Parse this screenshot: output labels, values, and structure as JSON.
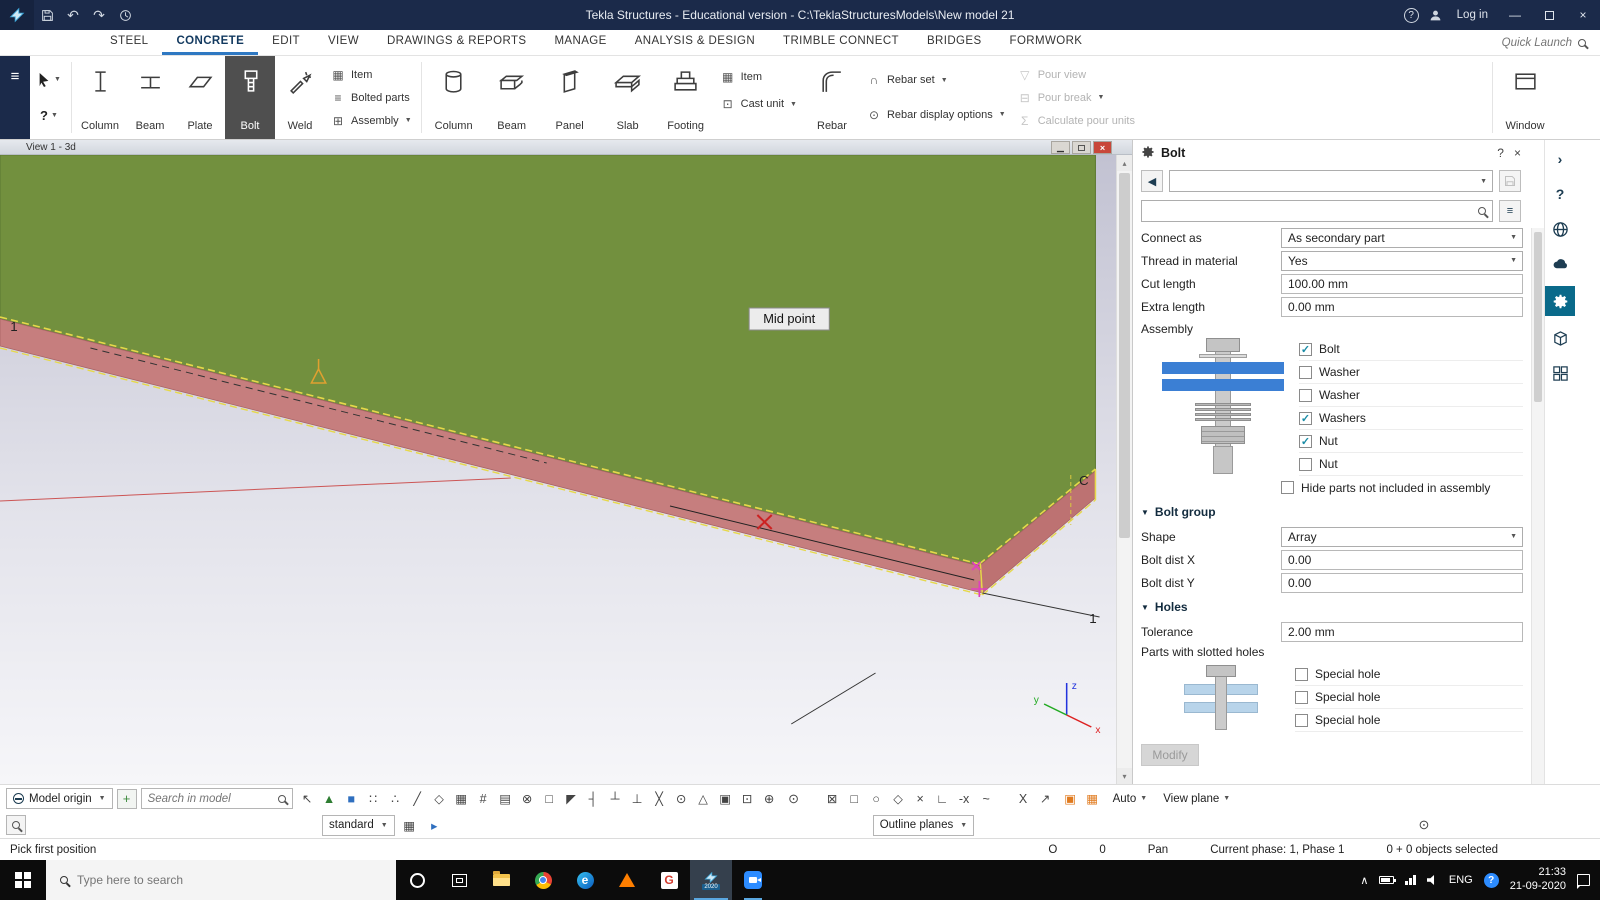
{
  "titlebar": {
    "title": "Tekla Structures - Educational version - C:\\TeklaStructuresModels\\New model 21",
    "login": "Log in"
  },
  "tabs": {
    "quick_launch": "Quick Launch",
    "items": [
      {
        "name": "tab-steel",
        "label": "STEEL"
      },
      {
        "name": "tab-concrete",
        "label": "CONCRETE",
        "active": true
      },
      {
        "name": "tab-edit",
        "label": "EDIT"
      },
      {
        "name": "tab-view",
        "label": "VIEW"
      },
      {
        "name": "tab-drawings-reports",
        "label": "DRAWINGS & REPORTS"
      },
      {
        "name": "tab-manage",
        "label": "MANAGE"
      },
      {
        "name": "tab-analysis-design",
        "label": "ANALYSIS & DESIGN"
      },
      {
        "name": "tab-trimble-connect",
        "label": "TRIMBLE CONNECT"
      },
      {
        "name": "tab-bridges",
        "label": "BRIDGES"
      },
      {
        "name": "tab-formwork",
        "label": "FORMWORK"
      }
    ]
  },
  "ribbon": {
    "steel_tiles": [
      {
        "label": "Column"
      },
      {
        "label": "Beam"
      },
      {
        "label": "Plate"
      },
      {
        "label": "Bolt",
        "active": true
      },
      {
        "label": "Weld"
      }
    ],
    "steel_stack": [
      {
        "label": "Item"
      },
      {
        "label": "Bolted parts"
      },
      {
        "label": "Assembly"
      }
    ],
    "concrete_tiles": [
      {
        "label": "Column"
      },
      {
        "label": "Beam"
      },
      {
        "label": "Panel"
      },
      {
        "label": "Slab"
      },
      {
        "label": "Footing"
      }
    ],
    "concrete_stack": [
      {
        "label": "Item"
      },
      {
        "label": "Cast unit"
      }
    ],
    "rebar_tile": {
      "label": "Rebar"
    },
    "rebar_stack": [
      {
        "label": "Rebar set"
      },
      {
        "label": "Rebar display options"
      }
    ],
    "pour_stack": [
      {
        "label": "Pour view"
      },
      {
        "label": "Pour break"
      },
      {
        "label": "Calculate pour units"
      }
    ],
    "window_tile": {
      "label": "Window"
    }
  },
  "viewport": {
    "window_title": "View 1 - 3d",
    "tooltip": "Mid point",
    "grid_left": "1",
    "grid_bottom": "1",
    "grid_c": "C",
    "axis_x": "x",
    "axis_y": "y",
    "axis_z": "z"
  },
  "bolt_panel": {
    "title": "Bolt",
    "connect_as": {
      "label": "Connect as",
      "value": "As secondary part"
    },
    "thread": {
      "label": "Thread in material",
      "value": "Yes"
    },
    "cut_length": {
      "label": "Cut length",
      "value": "100.00 mm"
    },
    "extra_length": {
      "label": "Extra length",
      "value": "0.00 mm"
    },
    "assembly_label": "Assembly",
    "assembly_checks": [
      {
        "name": "check-bolt",
        "label": "Bolt",
        "checked": true
      },
      {
        "name": "check-washer-1",
        "label": "Washer",
        "checked": false
      },
      {
        "name": "check-washer-2",
        "label": "Washer",
        "checked": false
      },
      {
        "name": "check-washers",
        "label": "Washers",
        "checked": true
      },
      {
        "name": "check-nut-1",
        "label": "Nut",
        "checked": true
      },
      {
        "name": "check-nut-2",
        "label": "Nut",
        "checked": false
      }
    ],
    "hide_parts": "Hide parts not included in assembly",
    "group": {
      "title": "Bolt group",
      "shape": {
        "label": "Shape",
        "value": "Array"
      },
      "dist_x": {
        "label": "Bolt dist X",
        "value": "0.00"
      },
      "dist_y": {
        "label": "Bolt dist Y",
        "value": "0.00"
      }
    },
    "holes": {
      "title": "Holes",
      "tolerance": {
        "label": "Tolerance",
        "value": "2.00 mm"
      },
      "slotted_label": "Parts with slotted holes",
      "special": [
        {
          "name": "special-hole-1",
          "label": "Special hole",
          "checked": false
        },
        {
          "name": "special-hole-2",
          "label": "Special hole",
          "checked": false
        },
        {
          "name": "special-hole-3",
          "label": "Special hole",
          "checked": false
        }
      ]
    },
    "modify_label": "Modify"
  },
  "bottom": {
    "model_origin": "Model origin",
    "search_placeholder": "Search in model",
    "standard": "standard",
    "outline_planes": "Outline planes",
    "auto": "Auto",
    "view_plane": "View plane",
    "snap_row1": [
      {
        "name": "select-cursor-icon",
        "glyph": "↖"
      },
      {
        "name": "select-components-icon",
        "glyph": "▲",
        "color": "#2e7d32"
      },
      {
        "name": "select-objects-icon",
        "glyph": "■",
        "color": "#2f6fbf"
      },
      {
        "name": "snap-reference-points-icon",
        "glyph": "∷"
      },
      {
        "name": "snap-geometry-points-icon",
        "glyph": "∴"
      },
      {
        "name": "snap-line-icon",
        "glyph": "╱"
      },
      {
        "name": "snap-polygon-icon",
        "glyph": "◇"
      },
      {
        "name": "snap-grid-icon",
        "glyph": "▦"
      },
      {
        "name": "snap-grid-lines-icon",
        "glyph": "#"
      },
      {
        "name": "snap-plane-icon",
        "glyph": "▤"
      },
      {
        "name": "snap-cut-icon",
        "glyph": "⊗"
      },
      {
        "name": "snap-box-icon",
        "glyph": "□"
      },
      {
        "name": "snap-corner-icon",
        "glyph": "◤"
      },
      {
        "name": "snap-end-point-icon",
        "glyph": "┤"
      },
      {
        "name": "snap-mid-point-icon",
        "glyph": "┴"
      },
      {
        "name": "snap-perpendicular-icon",
        "glyph": "⊥"
      },
      {
        "name": "snap-intersection-icon",
        "glyph": "╳"
      },
      {
        "name": "snap-center-icon",
        "glyph": "⊙"
      },
      {
        "name": "snap-tangent-icon",
        "glyph": "△"
      },
      {
        "name": "snap-nearest-icon",
        "glyph": "▣"
      },
      {
        "name": "snap-any-icon",
        "glyph": "⊡"
      },
      {
        "name": "snap-free-icon",
        "glyph": "⊕"
      }
    ],
    "view_tools": [
      {
        "name": "clip-plane-icon",
        "glyph": "⊠"
      },
      {
        "name": "view-rect-icon",
        "glyph": "□"
      },
      {
        "name": "view-circle-icon",
        "glyph": "○"
      },
      {
        "name": "view-diamond-icon",
        "glyph": "◇"
      },
      {
        "name": "delete-mark-icon",
        "glyph": "×"
      },
      {
        "name": "ortho-view-icon",
        "glyph": "∟"
      },
      {
        "name": "minus-x-icon",
        "glyph": "-x"
      },
      {
        "name": "axis-lock-icon",
        "glyph": "~"
      }
    ],
    "zoom_tools": [
      {
        "name": "zoom-selected-icon",
        "glyph": "X"
      },
      {
        "name": "pan-arrow-icon",
        "glyph": "↗"
      }
    ],
    "orange_tools": [
      {
        "name": "work-plane-icon",
        "glyph": "▣",
        "color": "#e07a1e"
      },
      {
        "name": "work-area-icon",
        "glyph": "▦",
        "color": "#e07a1e"
      }
    ]
  },
  "statusbar": {
    "left": "Pick first position",
    "o": "O",
    "zero": "0",
    "pan": "Pan",
    "phase": "Current phase: 1, Phase 1",
    "selected": "0 + 0 objects selected"
  },
  "taskbar": {
    "search_placeholder": "Type here to search",
    "tekla_badge": "2020",
    "lang": "ENG",
    "time": "21:33",
    "date": "21-09-2020"
  }
}
